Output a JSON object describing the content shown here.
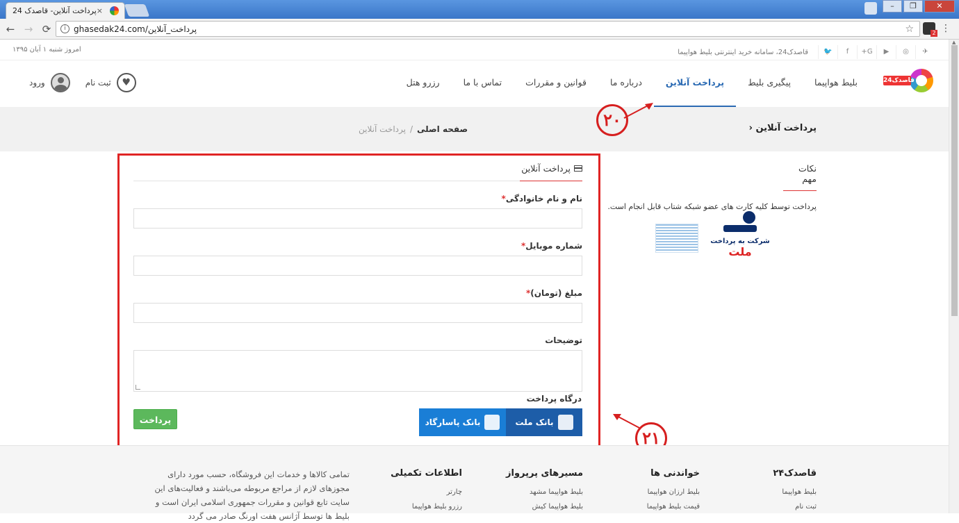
{
  "browser": {
    "tab_title": "پرداخت آنلاین- قاصدک 24",
    "tab_close": "×",
    "window_buttons": [
      "–",
      "❐",
      "✕"
    ],
    "url": "ghasedak24.com/پرداخت_آنلاین",
    "nav": {
      "back": "←",
      "forward": "→",
      "reload": "⟳",
      "info": "i",
      "star": "☆",
      "menu": "⋮"
    }
  },
  "topbar": {
    "date": "امروز شنبه ۱ آبان ۱۳۹۵",
    "tagline": "قاصدک24، سامانه خرید اینترنتی بلیط هواپیما",
    "social": [
      "✈",
      "◎",
      "▶",
      "G+",
      "f",
      "🐦"
    ]
  },
  "logo": {
    "text": "قاصدک24"
  },
  "nav": {
    "items": [
      "بلیط هواپیما",
      "پیگیری بلیط",
      "پرداخت آنلاین",
      "درباره ما",
      "قوانین و مقررات",
      "تماس با ما",
      "رزرو هتل"
    ],
    "active_index": 2,
    "register": "ثبت نام",
    "login": "ورود"
  },
  "page": {
    "title": "پرداخت آنلاین",
    "breadcrumb_home": "صفحه اصلی",
    "breadcrumb_sep": "/",
    "breadcrumb_current": "پرداخت آنلاین"
  },
  "annotations": {
    "a20": "۲۰",
    "a21": "۲۱"
  },
  "form": {
    "header": "پرداخت آنلاین",
    "name_label": "نام و نام خانوادگی",
    "mobile_label": "شماره موبایل",
    "amount_label": "مبلغ (تومان)",
    "desc_label": "توضیحات",
    "required_mark": "*",
    "gateway_label": "درگاه پرداخت",
    "gateways": [
      "بانک ملت",
      "بانک پاسارگاد"
    ],
    "submit": "پرداخت"
  },
  "side": {
    "header": "نکات مهم",
    "note": "پرداخت توسط کلیه کارت های عضو شبکه شتاب قابل انجام است.",
    "mellat_line1": "شرکت به پرداخت",
    "mellat_line2": "ملت"
  },
  "footer": {
    "col1": {
      "title": "قاصدک۲۴",
      "links": [
        "بلیط هواپیما",
        "ثبت نام"
      ]
    },
    "col2": {
      "title": "خواندنی ها",
      "links": [
        "بلیط ارزان هواپیما",
        "قیمت بلیط هواپیما"
      ]
    },
    "col3": {
      "title": "مسیرهای پرپرواز",
      "links": [
        "بلیط هواپیما مشهد",
        "بلیط هواپیما کیش"
      ]
    },
    "col4": {
      "title": "اطلاعات تکمیلی",
      "links": [
        "چارتر",
        "رزرو بلیط هواپیما"
      ]
    },
    "about": "تمامی کالاها و خدمات این فروشگاه، حسب مورد دارای مجوزهای لازم از مراجع مربوطه می‌باشند و فعالیت‌های این سایت تابع قوانین و مقررات جمهوری اسلامی ایران است و بلیط ها توسط آژانس هفت اورنگ صادر می گردد"
  },
  "colors": {
    "accent": "#2a6ab3",
    "annotation": "#d61f1f",
    "pay_button": "#5cb85c",
    "mellat": "#1d5da8",
    "pasargad": "#1a7ed6"
  }
}
